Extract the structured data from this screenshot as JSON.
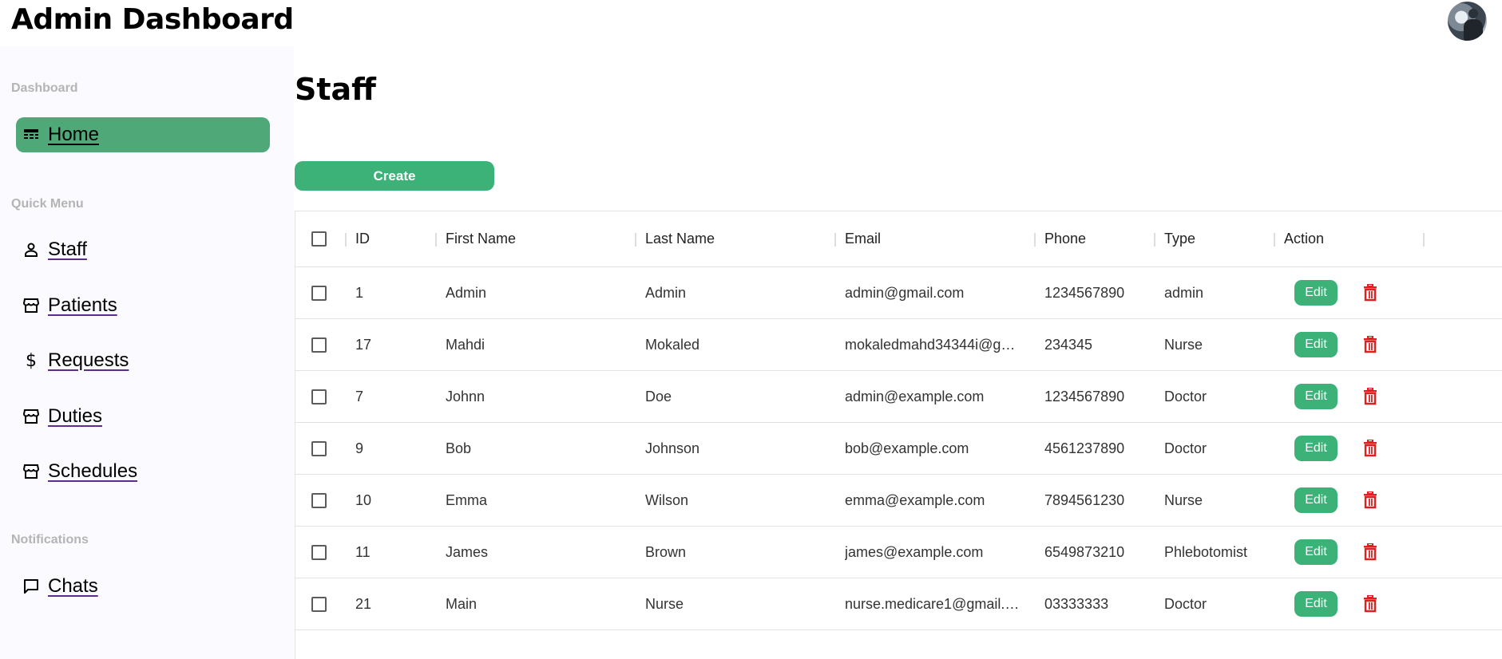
{
  "app": {
    "title": "Admin Dashboard"
  },
  "sidebar": {
    "sections": [
      {
        "title": "Dashboard",
        "items": [
          {
            "label": "Home",
            "icon": "dashboard-icon",
            "active": true
          }
        ]
      },
      {
        "title": "Quick Menu",
        "items": [
          {
            "label": "Staff",
            "icon": "person-icon"
          },
          {
            "label": "Patients",
            "icon": "storefront-icon"
          },
          {
            "label": "Requests",
            "icon": "dollar-icon"
          },
          {
            "label": "Duties",
            "icon": "storefront-icon"
          },
          {
            "label": "Schedules",
            "icon": "storefront-icon"
          }
        ]
      },
      {
        "title": "Notifications",
        "items": [
          {
            "label": "Chats",
            "icon": "chat-icon"
          }
        ]
      }
    ]
  },
  "main": {
    "page_title": "Staff",
    "create_label": "Create",
    "table": {
      "columns": [
        "ID",
        "First Name",
        "Last Name",
        "Email",
        "Phone",
        "Type",
        "Action"
      ],
      "rows": [
        {
          "id": "1",
          "first": "Admin",
          "last": "Admin",
          "email": "admin@gmail.com",
          "phone": "1234567890",
          "type": "admin"
        },
        {
          "id": "17",
          "first": "Mahdi",
          "last": "Mokaled",
          "email": "mokaledmahd34344i@g…",
          "phone": "234345",
          "type": "Nurse"
        },
        {
          "id": "7",
          "first": "Johnn",
          "last": "Doe",
          "email": "admin@example.com",
          "phone": "1234567890",
          "type": "Doctor"
        },
        {
          "id": "9",
          "first": "Bob",
          "last": "Johnson",
          "email": "bob@example.com",
          "phone": "4561237890",
          "type": "Doctor"
        },
        {
          "id": "10",
          "first": "Emma",
          "last": "Wilson",
          "email": "emma@example.com",
          "phone": "7894561230",
          "type": "Nurse"
        },
        {
          "id": "11",
          "first": "James",
          "last": "Brown",
          "email": "james@example.com",
          "phone": "6549873210",
          "type": "Phlebotomist"
        },
        {
          "id": "21",
          "first": "Main",
          "last": "Nurse",
          "email": "nurse.medicare1@gmail.…",
          "phone": "03333333",
          "type": "Doctor"
        }
      ],
      "edit_label": "Edit"
    }
  },
  "colors": {
    "accent": "#3cb178",
    "active_nav": "#4fa878",
    "delete": "#e02020",
    "sidebar_bg": "#fbfaff"
  }
}
